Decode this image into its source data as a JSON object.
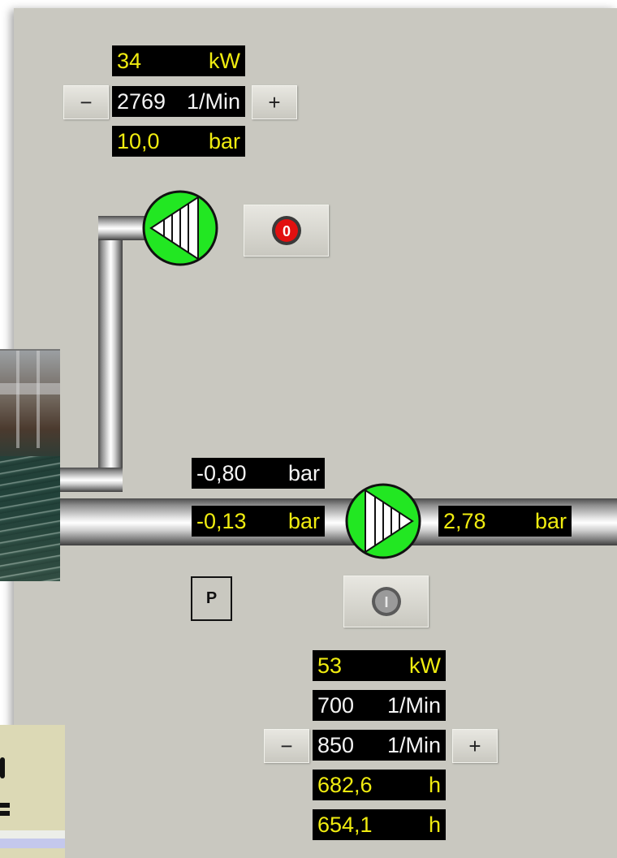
{
  "top_pump": {
    "power": {
      "value": "34",
      "unit": "kW"
    },
    "speed": {
      "value": "2769",
      "unit": "1/Min"
    },
    "pressure": {
      "value": "10,0",
      "unit": "bar"
    },
    "minus_label": "−",
    "plus_label": "+",
    "stop_label": "0",
    "status_color": "#22e722"
  },
  "suction": {
    "pressure_1": {
      "value": "-0,80",
      "unit": "bar"
    },
    "pressure_2": {
      "value": "-0,13",
      "unit": "bar"
    }
  },
  "discharge": {
    "pressure": {
      "value": "2,78",
      "unit": "bar"
    }
  },
  "bottom_pump": {
    "p_label": "P",
    "power": {
      "value": "53",
      "unit": "kW"
    },
    "speed_actual": {
      "value": "700",
      "unit": "1/Min"
    },
    "speed_set": {
      "value": "850",
      "unit": "1/Min"
    },
    "hours_1": {
      "value": "682,6",
      "unit": "h"
    },
    "hours_2": {
      "value": "654,1",
      "unit": "h"
    },
    "minus_label": "−",
    "plus_label": "+",
    "start_label": "I",
    "status_color": "#22e722"
  },
  "colors": {
    "panel": "#c9c8c0",
    "lcd_yellow": "#f0ec10",
    "lcd_white": "#f4f4f4",
    "stop_red": "#e21010"
  }
}
